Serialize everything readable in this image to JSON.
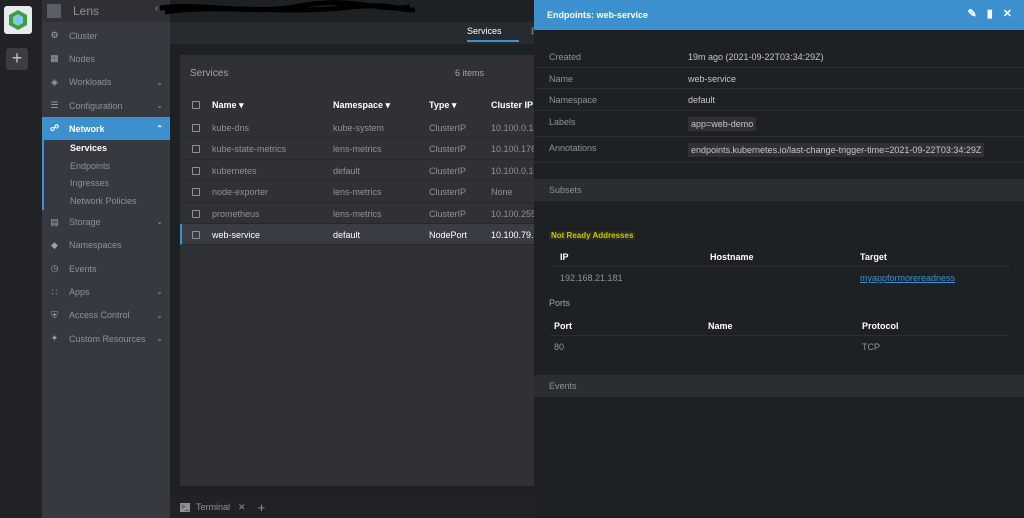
{
  "app": {
    "title": "Lens"
  },
  "sidebar": {
    "items": [
      {
        "label": "Cluster",
        "icon": "cluster-icon"
      },
      {
        "label": "Nodes",
        "icon": "nodes-icon"
      },
      {
        "label": "Workloads",
        "icon": "workloads-icon"
      },
      {
        "label": "Configuration",
        "icon": "configuration-icon"
      },
      {
        "label": "Network",
        "icon": "network-icon"
      },
      {
        "label": "Storage",
        "icon": "storage-icon"
      },
      {
        "label": "Namespaces",
        "icon": "namespaces-icon"
      },
      {
        "label": "Events",
        "icon": "events-icon"
      },
      {
        "label": "Apps",
        "icon": "apps-icon"
      },
      {
        "label": "Access Control",
        "icon": "access-control-icon"
      },
      {
        "label": "Custom Resources",
        "icon": "custom-resources-icon"
      }
    ],
    "network_sub": [
      "Services",
      "Endpoints",
      "Ingresses",
      "Network Policies"
    ]
  },
  "tabs": {
    "active": "Services"
  },
  "table": {
    "title": "Services",
    "count": "6 items",
    "headers": {
      "name": "Name",
      "namespace": "Namespace",
      "type": "Type",
      "cluster_ip": "Cluster IP"
    },
    "rows": [
      {
        "name": "kube-dns",
        "namespace": "kube-system",
        "type": "ClusterIP",
        "cluster_ip": "10.100.0.1"
      },
      {
        "name": "kube-state-metrics",
        "namespace": "lens-metrics",
        "type": "ClusterIP",
        "cluster_ip": "10.100.176"
      },
      {
        "name": "kubernetes",
        "namespace": "default",
        "type": "ClusterIP",
        "cluster_ip": "10.100.0.1"
      },
      {
        "name": "node-exporter",
        "namespace": "lens-metrics",
        "type": "ClusterIP",
        "cluster_ip": "None"
      },
      {
        "name": "prometheus",
        "namespace": "lens-metrics",
        "type": "ClusterIP",
        "cluster_ip": "10.100.255"
      },
      {
        "name": "web-service",
        "namespace": "default",
        "type": "NodePort",
        "cluster_ip": "10.100.79."
      }
    ]
  },
  "terminal": {
    "label": "Terminal"
  },
  "drawer": {
    "title": "Endpoints: web-service",
    "details": {
      "created_label": "Created",
      "created": "19m ago (2021-09-22T03:34:29Z)",
      "name_label": "Name",
      "name": "web-service",
      "namespace_label": "Namespace",
      "namespace": "default",
      "labels_label": "Labels",
      "labels": "app=web-demo",
      "annotations_label": "Annotations",
      "annotations": "endpoints.kubernetes.io/last-change-trigger-time=2021-09-22T03:34:29Z"
    },
    "subsets_label": "Subsets",
    "not_ready_label": "Not Ready Addresses",
    "addr_headers": {
      "ip": "IP",
      "hostname": "Hostname",
      "target": "Target"
    },
    "address": {
      "ip": "192.168.21.181",
      "hostname": "",
      "target": "myappformorereadness"
    },
    "ports_label": "Ports",
    "port_headers": {
      "port": "Port",
      "name": "Name",
      "protocol": "Protocol"
    },
    "port": {
      "port": "80",
      "name": "",
      "protocol": "TCP"
    },
    "events_label": "Events"
  },
  "colors": {
    "accent": "#3d90ce",
    "warning": "#c8c800"
  }
}
